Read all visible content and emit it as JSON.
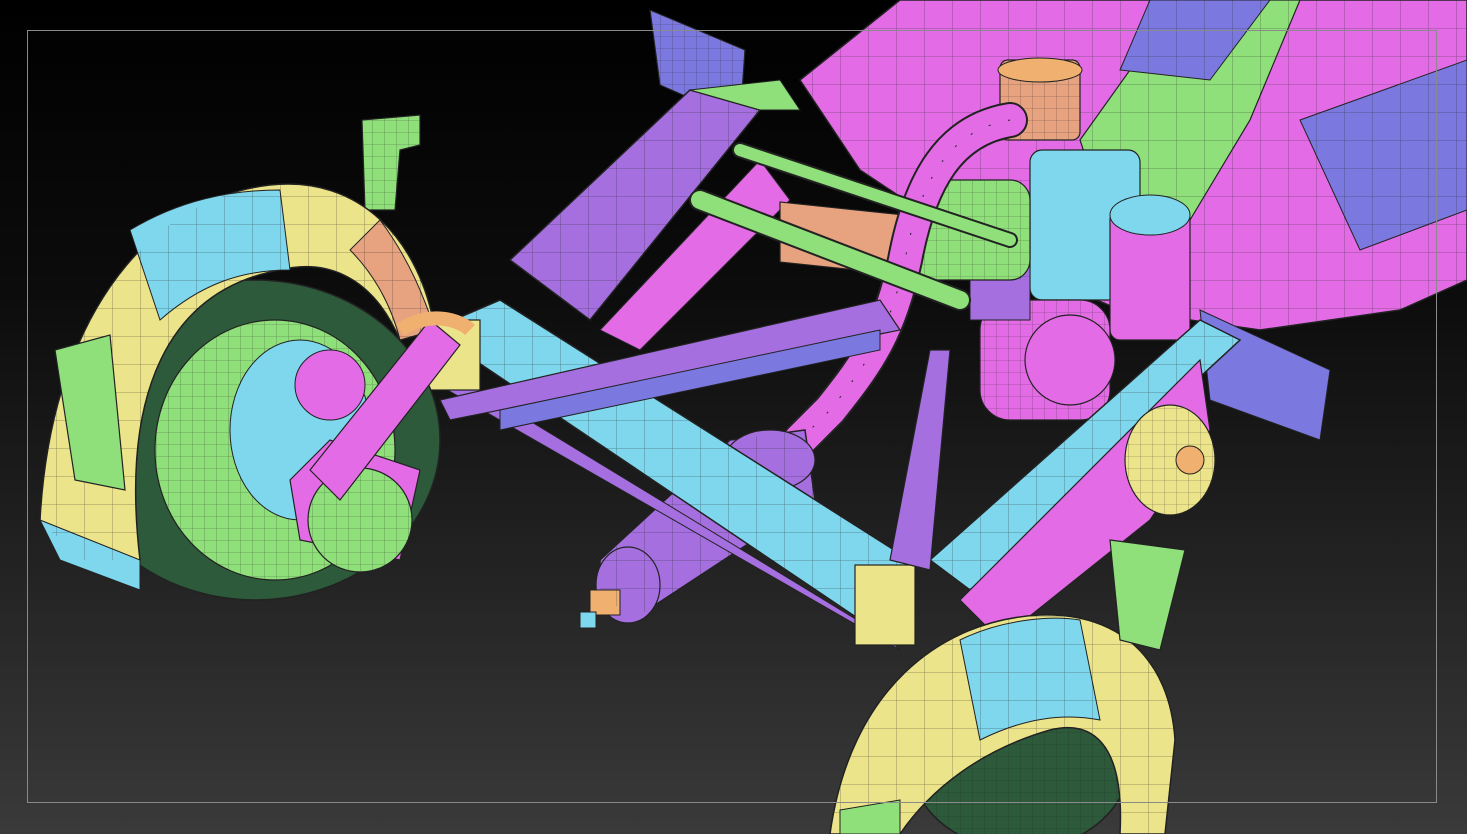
{
  "viewport": {
    "background_top": "#000000",
    "background_bottom": "#3a3a3a",
    "frame_color": "#8a8a8a"
  },
  "palette": {
    "magenta": "#e36ce6",
    "violet": "#a56fe0",
    "blue": "#7b78e0",
    "green": "#8fe07a",
    "cyan": "#7fd7ee",
    "yellow": "#ece48a",
    "salmon": "#e7a27f",
    "orange": "#f0b070",
    "wire": "#222222"
  },
  "icons": {
    "model": "car-chassis-wireframe-icon"
  }
}
